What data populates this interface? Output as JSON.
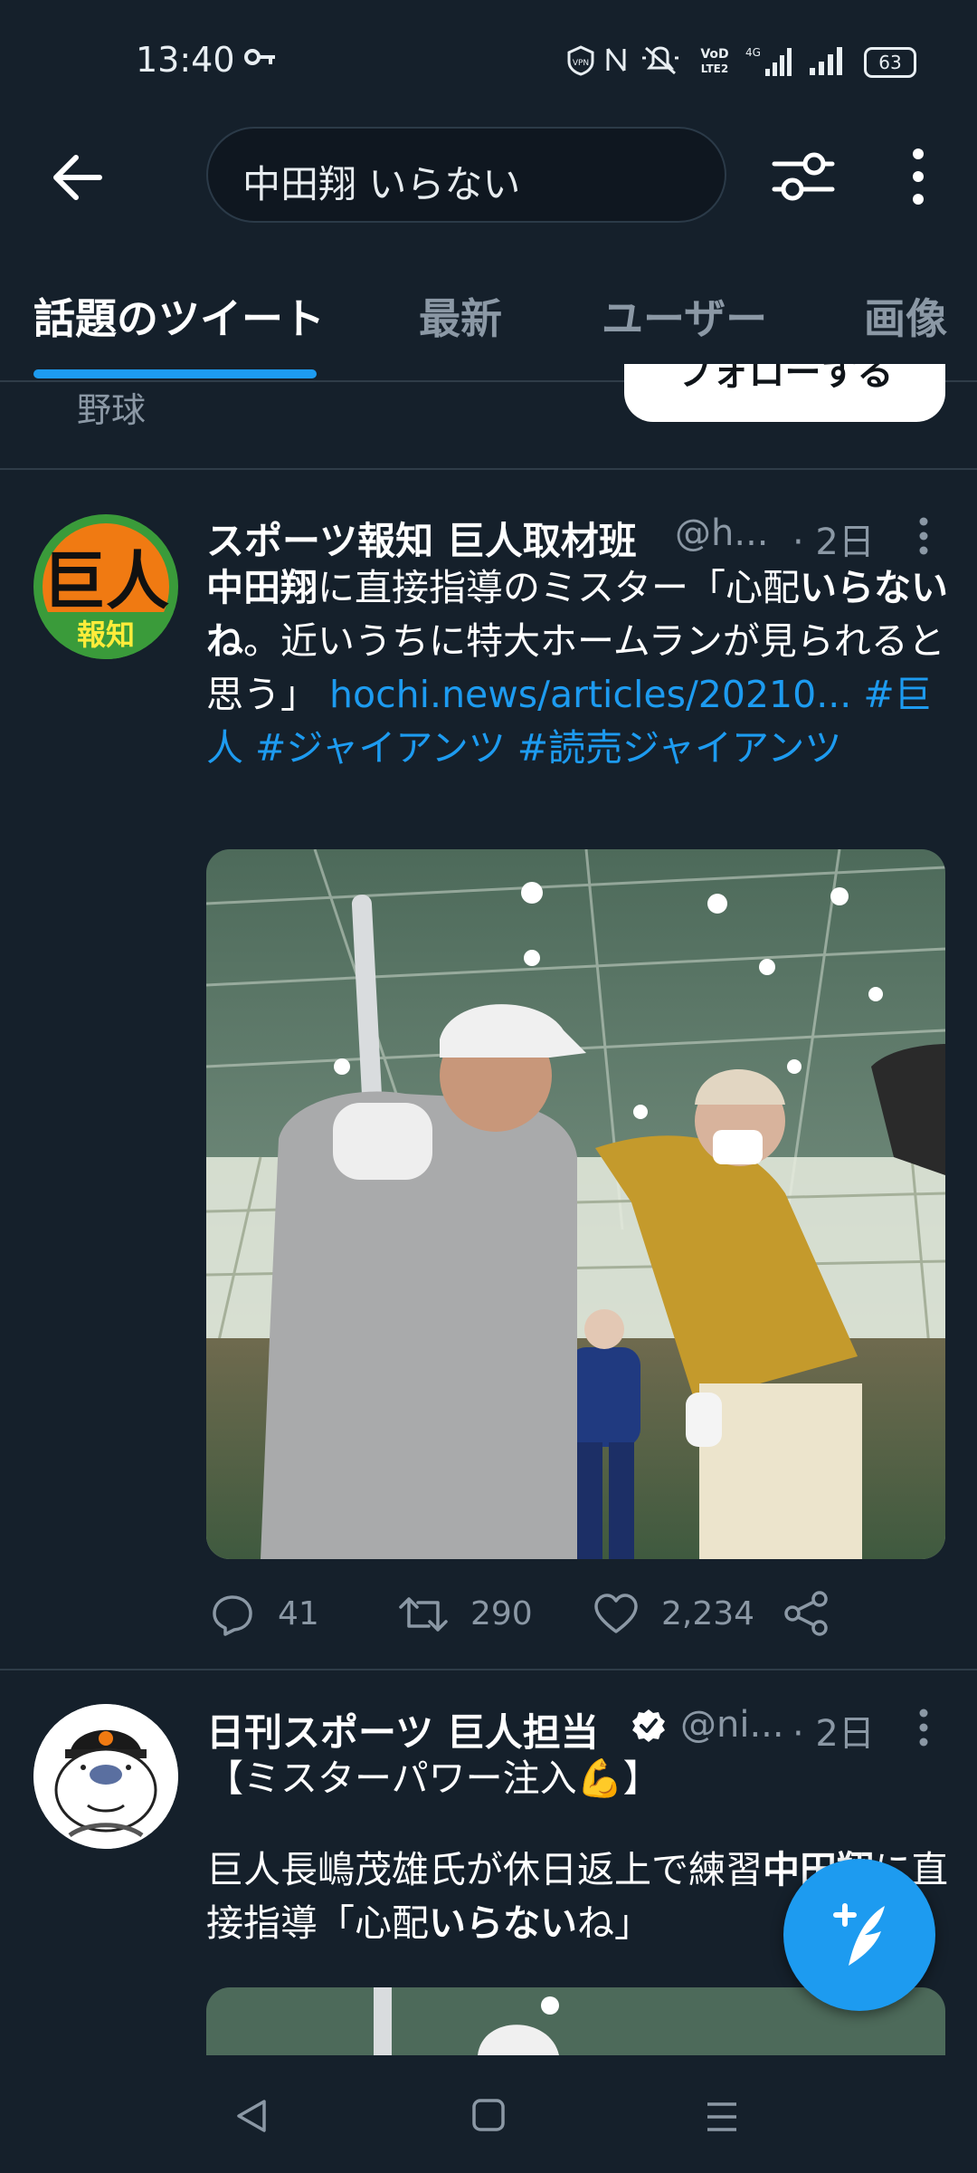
{
  "status_bar": {
    "time": "13:40",
    "battery": "63",
    "icons": [
      "key-icon",
      "vpn-icon",
      "nfc-icon",
      "mute-icon",
      "volte-icon",
      "4g-signal-icon",
      "signal-icon",
      "battery-icon"
    ]
  },
  "header": {
    "search_query": "中田翔 いらない",
    "back_icon": "arrow-left-icon",
    "filter_icon": "filter-sliders-icon",
    "more_icon": "more-vertical-icon"
  },
  "tabs": [
    "話題のツイート",
    "最新",
    "ユーザー",
    "画像"
  ],
  "prev_row": {
    "label": "野球",
    "button_label": "フォローする"
  },
  "tweets": [
    {
      "name": "スポーツ報知 巨人取材班",
      "handle": "@h...",
      "time": "· 2日",
      "avatar_text_top": "巨人",
      "avatar_text_bottom": "報知",
      "body_bold_1": "中田翔",
      "body_1": "に直接指導のミスター「心配",
      "body_bold_2": "いらないね",
      "body_2": "。近いうちに特大ホームランが見られると思う」 ",
      "link": "hochi.news/articles/20210...",
      "hashtags": " #巨人 #ジャイアンツ #読売ジャイアンツ",
      "replies": "41",
      "retweets": "290",
      "likes": "2,234"
    },
    {
      "name": "日刊スポーツ 巨人担当",
      "handle": "@ni...",
      "time": "· 2日",
      "line_1": "【ミスターパワー注入💪】",
      "line_2a": "巨人長嶋茂雄氏が休日返上で練習",
      "line_2b_bold": "中田翔",
      "line_2c": "に直接指導「心配",
      "line_2d_bold": "いらない",
      "line_2e": "ね」"
    }
  ],
  "fab_icon": "compose-tweet-icon",
  "nav_bar": [
    "back-nav-icon",
    "home-nav-icon",
    "recents-nav-icon"
  ],
  "colors": {
    "background": "#15202b",
    "accent": "#1d9bf0",
    "secondary_text": "#8b98a5",
    "divider": "#2f3c48"
  }
}
